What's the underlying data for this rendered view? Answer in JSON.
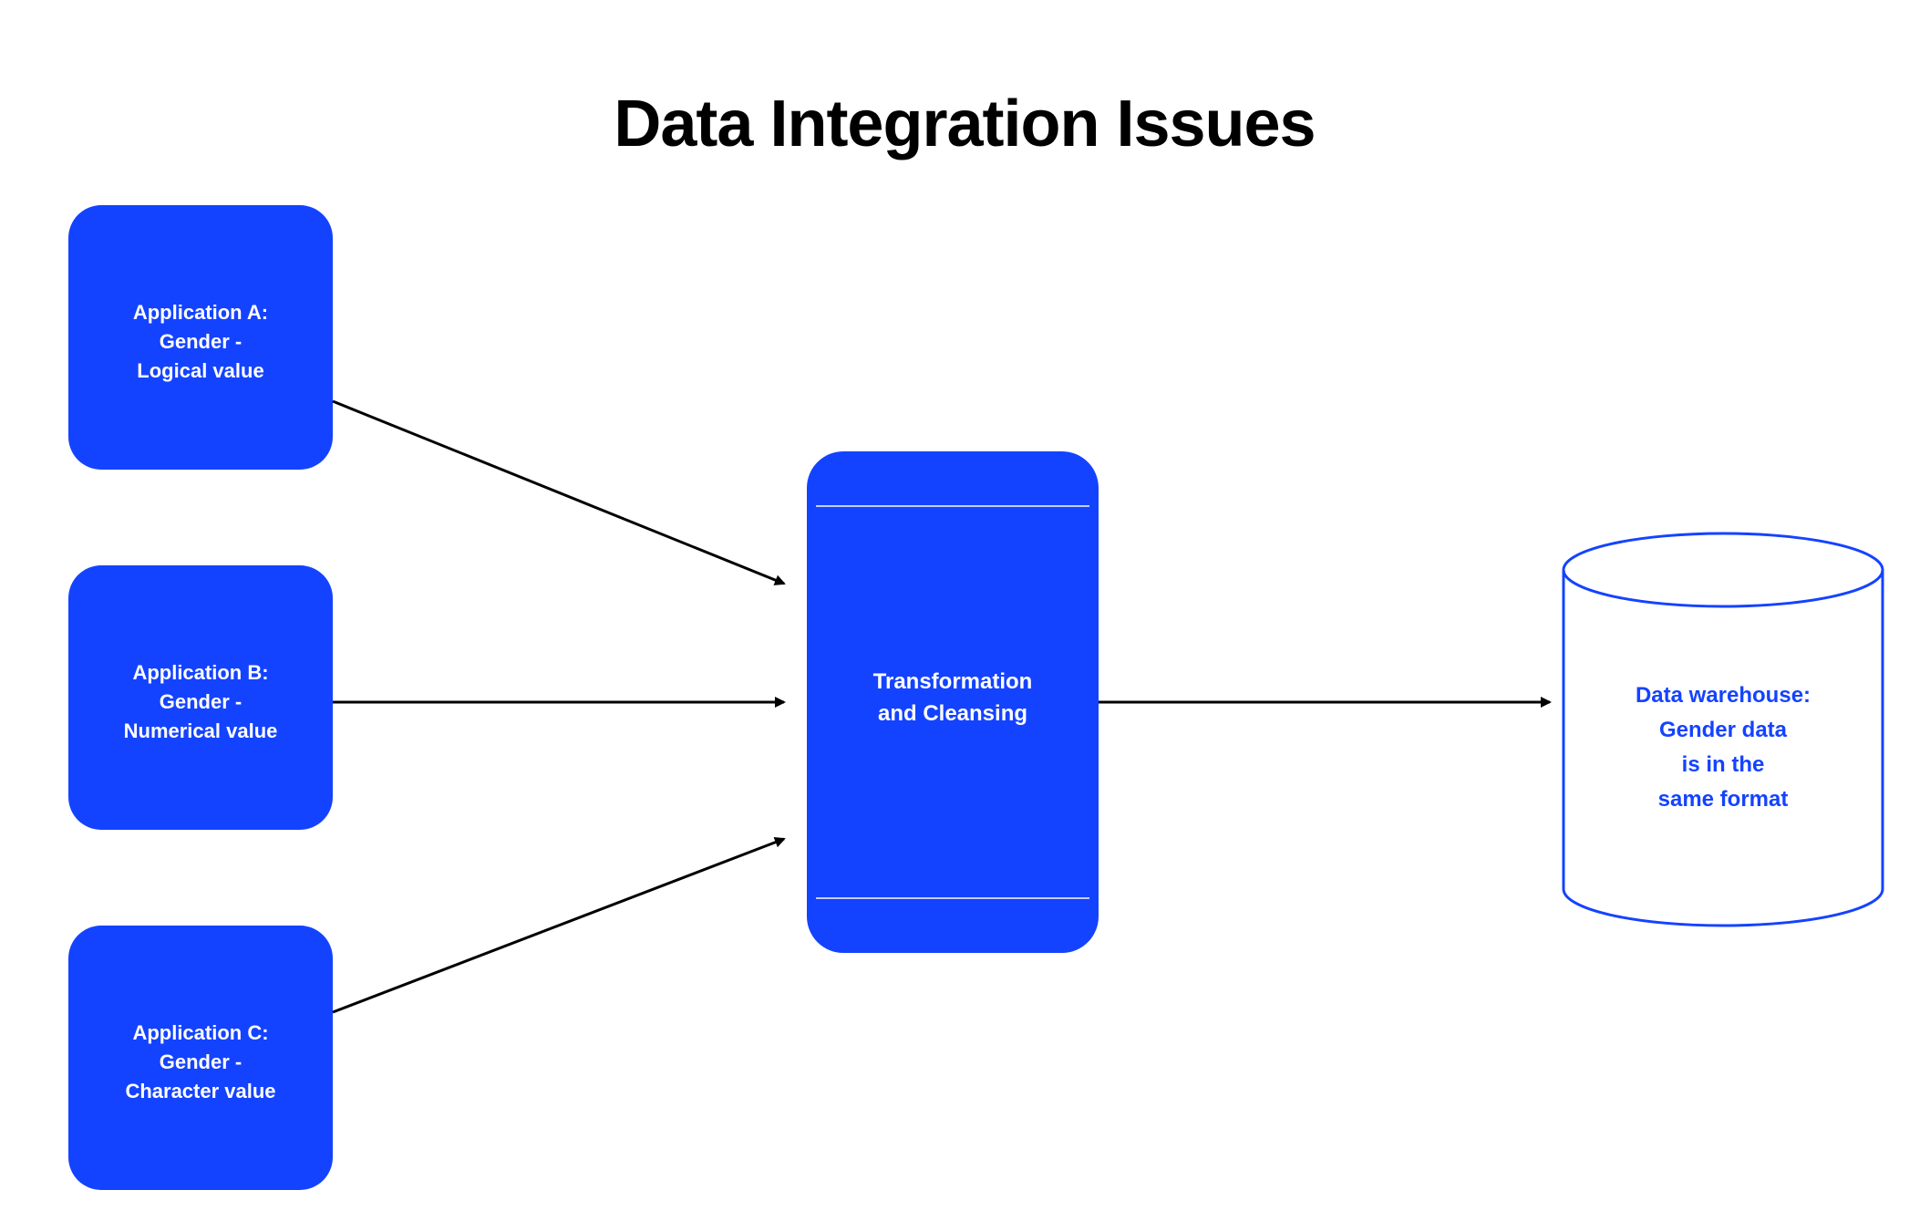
{
  "title": "Data Integration Issues",
  "colors": {
    "primary": "#1443ff",
    "title": "#000000",
    "arrow": "#000000",
    "background": "#ffffff"
  },
  "applications": [
    {
      "title": "Application A:",
      "line2": "Gender -",
      "line3": "Logical value"
    },
    {
      "title": "Application B:",
      "line2": "Gender -",
      "line3": "Numerical value"
    },
    {
      "title": "Application C:",
      "line2": "Gender -",
      "line3": "Character value"
    }
  ],
  "process": {
    "line1": "Transformation",
    "line2": "and Cleansing"
  },
  "warehouse": {
    "line1": "Data warehouse:",
    "line2": "Gender data",
    "line3": "is in the",
    "line4": "same format"
  }
}
